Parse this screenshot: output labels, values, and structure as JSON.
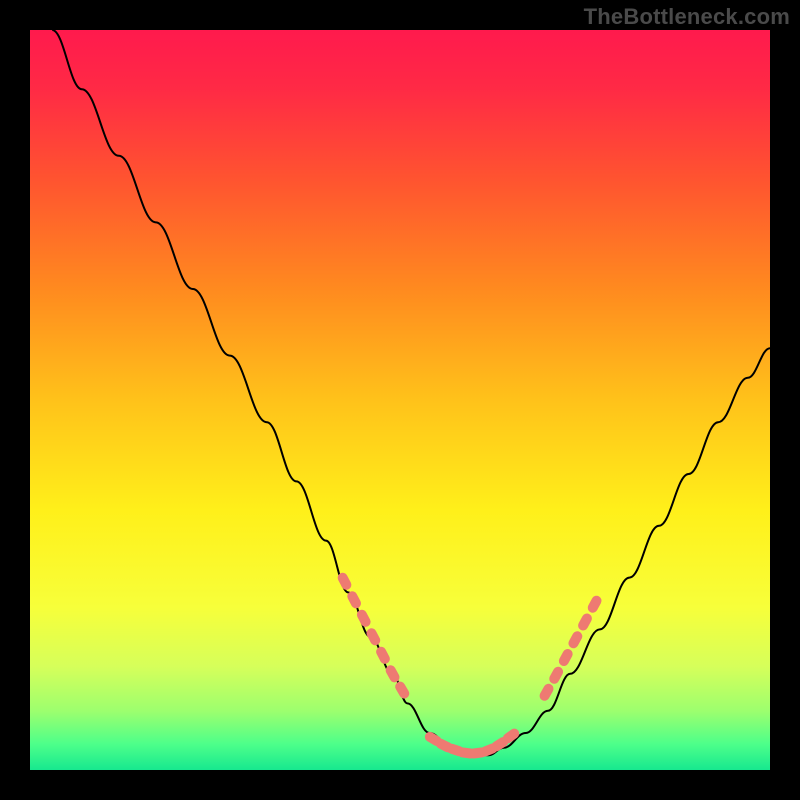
{
  "watermark": "TheBottleneck.com",
  "colors": {
    "background": "#000000",
    "watermark_text": "#4a4a4a",
    "curve_stroke": "#000000",
    "marker_fill": "#ee7a72",
    "gradient_stops": [
      {
        "offset": 0.0,
        "color": "#ff1a4d"
      },
      {
        "offset": 0.08,
        "color": "#ff2a45"
      },
      {
        "offset": 0.2,
        "color": "#ff5330"
      },
      {
        "offset": 0.35,
        "color": "#ff8a1f"
      },
      {
        "offset": 0.5,
        "color": "#ffc21a"
      },
      {
        "offset": 0.65,
        "color": "#fff01a"
      },
      {
        "offset": 0.78,
        "color": "#f7ff3a"
      },
      {
        "offset": 0.86,
        "color": "#d6ff5a"
      },
      {
        "offset": 0.92,
        "color": "#9dff6e"
      },
      {
        "offset": 0.965,
        "color": "#4dff8a"
      },
      {
        "offset": 1.0,
        "color": "#17e88f"
      }
    ]
  },
  "chart_data": {
    "type": "line",
    "title": "",
    "xlabel": "",
    "ylabel": "",
    "xlim": [
      0,
      100
    ],
    "ylim": [
      0,
      100
    ],
    "series": [
      {
        "name": "bottleneck-curve",
        "x": [
          3,
          7,
          12,
          17,
          22,
          27,
          32,
          36,
          40,
          43,
          46,
          49,
          51,
          54,
          57,
          60,
          62,
          64,
          67,
          70,
          73,
          77,
          81,
          85,
          89,
          93,
          97,
          100
        ],
        "y": [
          100,
          92,
          83,
          74,
          65,
          56,
          47,
          39,
          31,
          24,
          18,
          13,
          9,
          5,
          3,
          2,
          2,
          3,
          5,
          8,
          13,
          19,
          26,
          33,
          40,
          47,
          53,
          57
        ]
      }
    ],
    "marker_clusters": [
      {
        "name": "left-descent",
        "points": [
          {
            "x": 42.5,
            "y": 25.5
          },
          {
            "x": 43.8,
            "y": 23.0
          },
          {
            "x": 45.1,
            "y": 20.5
          },
          {
            "x": 46.4,
            "y": 18.0
          },
          {
            "x": 47.7,
            "y": 15.5
          },
          {
            "x": 49.0,
            "y": 13.0
          },
          {
            "x": 50.3,
            "y": 10.8
          }
        ]
      },
      {
        "name": "valley",
        "points": [
          {
            "x": 54.5,
            "y": 4.2
          },
          {
            "x": 56.0,
            "y": 3.3
          },
          {
            "x": 57.5,
            "y": 2.7
          },
          {
            "x": 59.0,
            "y": 2.3
          },
          {
            "x": 60.5,
            "y": 2.3
          },
          {
            "x": 62.0,
            "y": 2.7
          },
          {
            "x": 63.5,
            "y": 3.5
          },
          {
            "x": 65.0,
            "y": 4.6
          }
        ]
      },
      {
        "name": "right-ascent",
        "points": [
          {
            "x": 69.8,
            "y": 10.5
          },
          {
            "x": 71.1,
            "y": 12.8
          },
          {
            "x": 72.4,
            "y": 15.2
          },
          {
            "x": 73.7,
            "y": 17.6
          },
          {
            "x": 75.0,
            "y": 20.0
          },
          {
            "x": 76.3,
            "y": 22.4
          }
        ]
      }
    ]
  }
}
